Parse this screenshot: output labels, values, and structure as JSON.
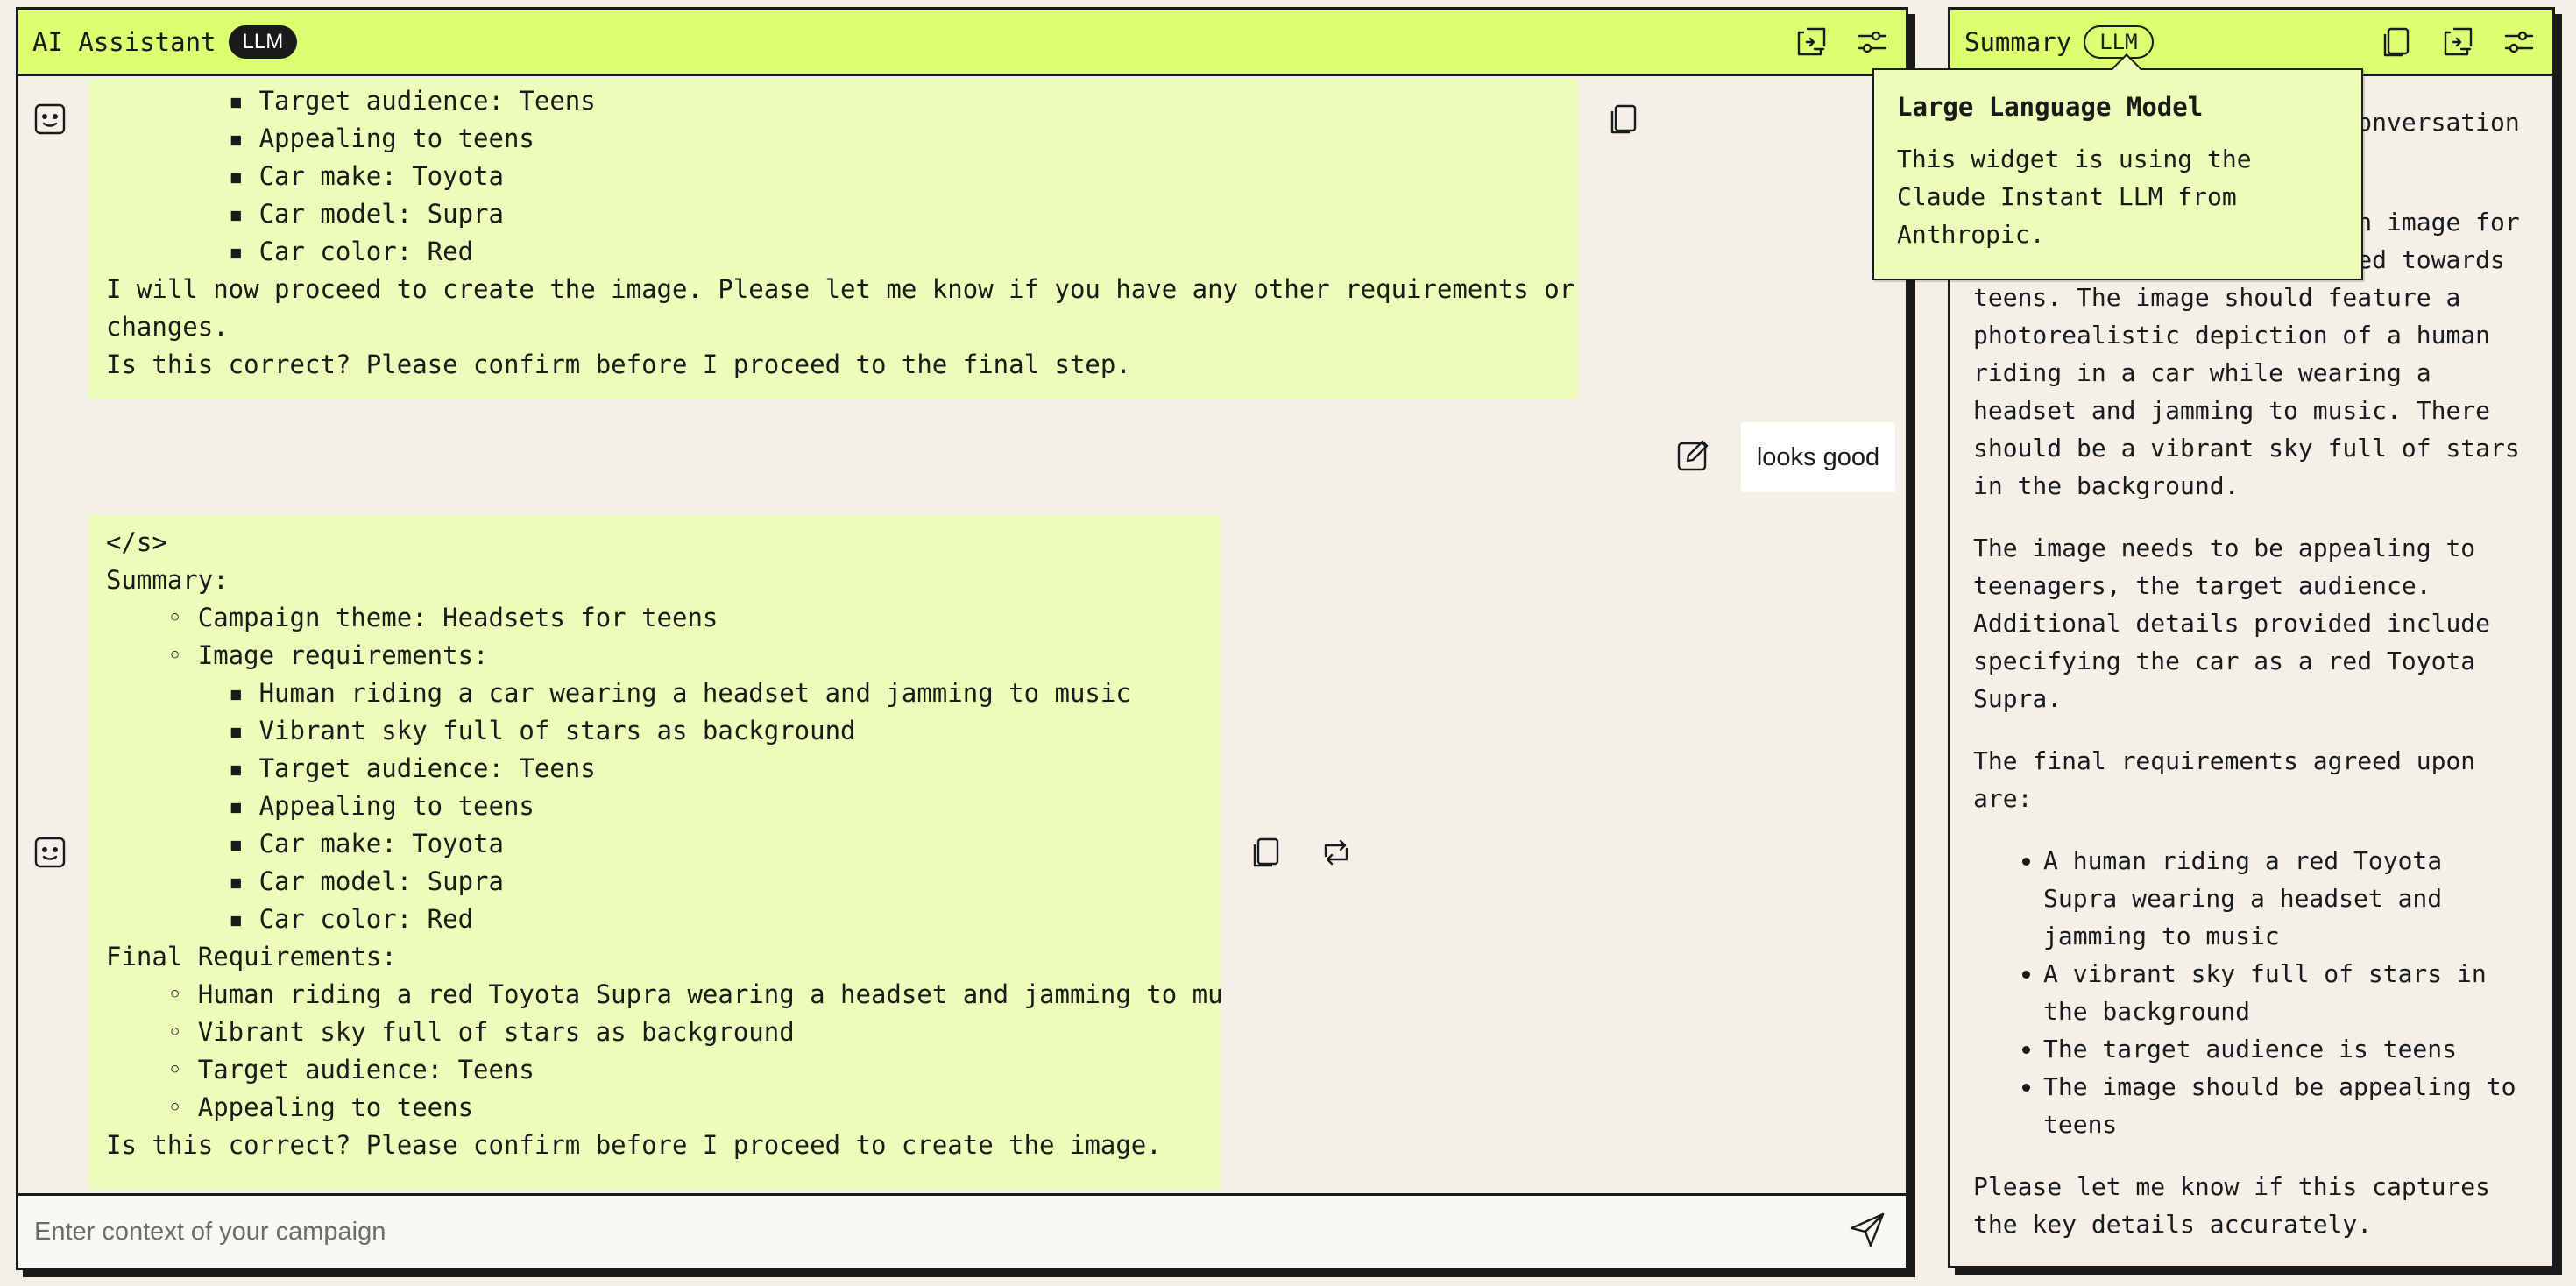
{
  "assistant": {
    "title": "AI Assistant",
    "badge": "LLM",
    "icons": [
      "share-icon",
      "settings-sliders-icon"
    ]
  },
  "messages": {
    "first": {
      "lines": [
        "        ▪ Target audience: Teens",
        "        ▪ Appealing to teens",
        "        ▪ Car make: Toyota",
        "        ▪ Car model: Supra",
        "        ▪ Car color: Red",
        "I will now proceed to create the image. Please let me know if you have any other requirements or",
        "changes.",
        "Is this correct? Please confirm before I proceed to the final step."
      ]
    },
    "user": "looks good",
    "second": {
      "lines": [
        "</s>",
        "Summary:",
        "    ◦ Campaign theme: Headsets for teens",
        "    ◦ Image requirements:",
        "        ▪ Human riding a car wearing a headset and jamming to music",
        "        ▪ Vibrant sky full of stars as background",
        "        ▪ Target audience: Teens",
        "        ▪ Appealing to teens",
        "        ▪ Car make: Toyota",
        "        ▪ Car model: Supra",
        "        ▪ Car color: Red",
        "Final Requirements:",
        "    ◦ Human riding a red Toyota Supra wearing a headset and jamming to music",
        "    ◦ Vibrant sky full of stars as background",
        "    ◦ Target audience: Teens",
        "    ◦ Appealing to teens",
        "Is this correct? Please confirm before I proceed to create the image."
      ]
    }
  },
  "input": {
    "placeholder": "Enter context of your campaign"
  },
  "summary": {
    "title": "Summary",
    "badge": "LLM",
    "para1": "Here is a summary of the conversation of the",
    "para2": "The user wants to create an image for a headsets campaign targeted towards teens. The image should feature a photorealistic depiction of a human riding in a car while wearing a headset and jamming to music. There should be a vibrant sky full of stars in the background.",
    "para3": "The image needs to be appealing to teenagers, the target audience. Additional details provided include specifying the car as a red Toyota Supra.",
    "para4": "The final requirements agreed upon are:",
    "bullets": [
      "A human riding a red Toyota Supra wearing a headset and jamming to music",
      "A vibrant sky full of stars in the background",
      "The target audience is teens",
      "The image should be appealing to teens"
    ],
    "para5": "Please let me know if this captures the key details accurately."
  },
  "tooltip": {
    "title": "Large Language Model",
    "body": "This widget is using the Claude Instant LLM from Anthropic."
  }
}
